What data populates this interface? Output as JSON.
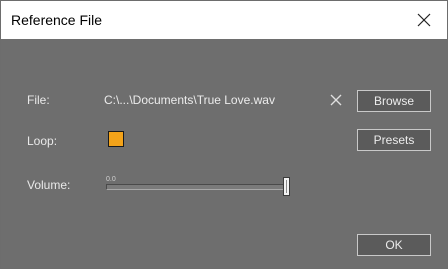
{
  "window": {
    "title": "Reference File"
  },
  "file": {
    "label": "File:",
    "path": "C:\\...\\Documents\\True Love.wav"
  },
  "loop": {
    "label": "Loop:",
    "checked": true,
    "color": "#f3a31a"
  },
  "volume": {
    "label": "Volume:",
    "value_text": "0.0",
    "level": 1.0
  },
  "buttons": {
    "browse": "Browse",
    "presets": "Presets",
    "ok": "OK"
  },
  "icons": {
    "close": "close-icon",
    "clear": "clear-file-icon"
  }
}
